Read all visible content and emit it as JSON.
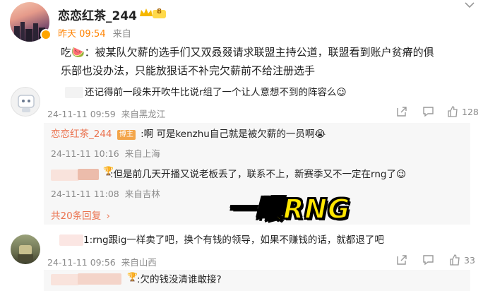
{
  "post": {
    "author": "恋恋红茶_244",
    "level_badge": "8",
    "time": "昨天 09:54",
    "source": "来自",
    "text_line1": "吃🍉：被某队欠薪的选手们又双叒叕请求联盟主持公道，联盟看到账户贫瘠的俱",
    "text_line2": "乐部也没办法，只能放狠话不补完欠薪前不给注册选手"
  },
  "comments": [
    {
      "text": "还记得前一段朱开吹牛比说r组了一个让人意想不到的阵容么😉",
      "date": "24-11-11 09:59",
      "location": "来自黑龙江",
      "likes": "128"
    },
    {
      "author": "恋恋红茶_244",
      "author_badge": "博主",
      "text": ":啊 可是kenzhu自己就是被欠薪的一员啊😭",
      "date": "24-11-11 10:16",
      "location": "来自上海"
    },
    {
      "text": ":但是前几天开播又说老板丢了，联系不上，新赛季又不一定在rng了😉",
      "date": "24-11-11 11:08",
      "location": "来自吉林"
    },
    {
      "text": "1:rng跟ig一样卖了吧，换个有钱的领导，如果不赚钱的话，就都退了吧",
      "date": "24-11-11 09:56",
      "location": "来自山西",
      "likes": "33"
    },
    {
      "text": ":欠的钱没清谁敢接?"
    }
  ],
  "more_replies": "共20条回复",
  "overlay_caption": "一眼RNG",
  "colors": {
    "accent_orange": "#ff8200",
    "link_blue": "#507daf",
    "gray_text": "#8a8a8a",
    "caption_yellow": "#ffe600"
  }
}
